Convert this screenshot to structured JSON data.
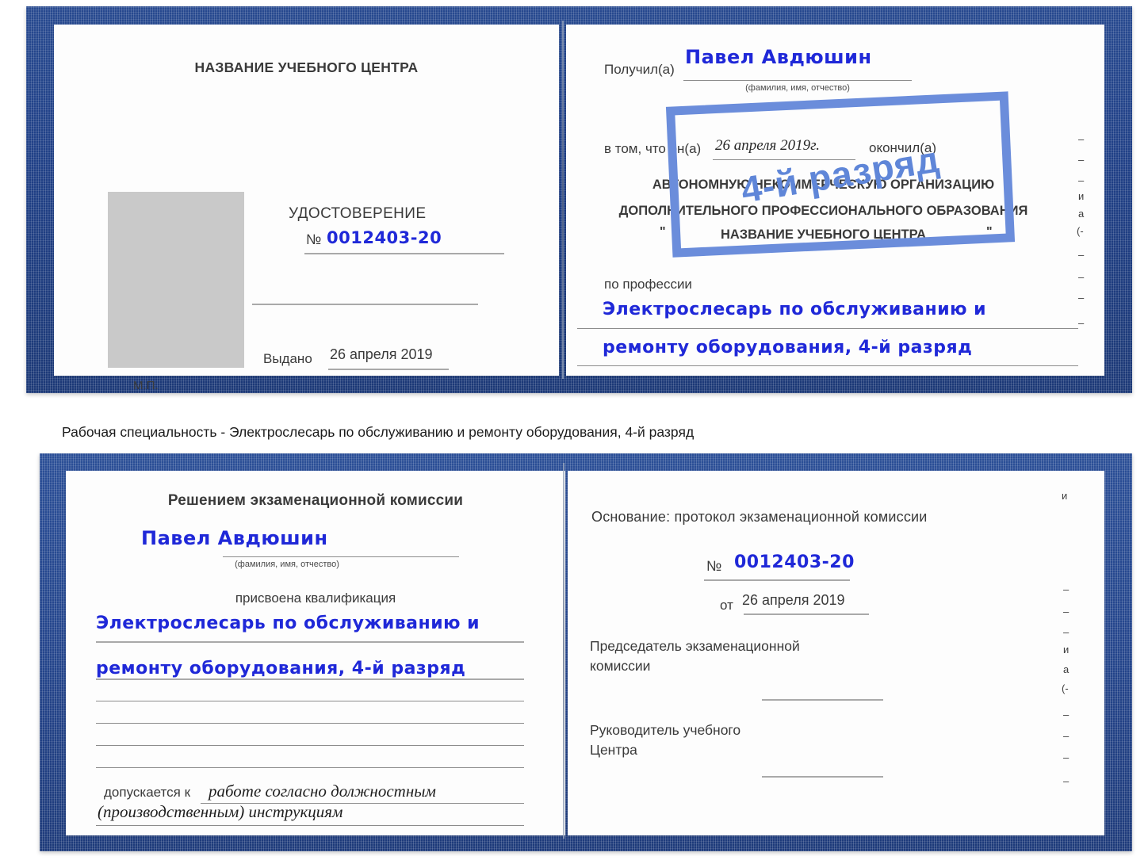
{
  "caption": {
    "text": "Рабочая специальность - Электрослесарь по обслуживанию и ремонту оборудования, 4-й разряд"
  },
  "certificate_top": {
    "left_page": {
      "header": "НАЗВАНИЕ УЧЕБНОГО ЦЕНТРА",
      "photo_placeholder": "",
      "title": "УДОСТОВЕРЕНИЕ",
      "number_symbol": "№",
      "number_value": "0012403-20",
      "issued_label": "Выдано",
      "issued_value": "26 апреля 2019",
      "seal_label": "М.П."
    },
    "right_page": {
      "received_label": "Получил(а)",
      "received_value": "Павел Авдюшин",
      "fio_hint": "(фамилия, имя, отчество)",
      "in_that_label": "в том, что он(а)",
      "date_value": "26 апреля 2019г.",
      "finished_label": "окончил(а)",
      "org_line1": "АВТОНОМНУЮ НЕКОММЕРЧЕСКУЮ ОРГАНИЗАЦИЮ",
      "org_line2": "ДОПОЛНИТЕЛЬНОГО ПРОФЕССИОНАЛЬНОГО ОБРАЗОВАНИЯ",
      "org_quote_open": "\"",
      "org_line3": "НАЗВАНИЕ УЧЕБНОГО ЦЕНТРА",
      "org_quote_close": "\"",
      "profession_label": "по профессии",
      "profession_line1": "Электрослесарь по обслуживанию и",
      "profession_line2": "ремонту оборудования, 4-й разряд",
      "stamp_text": "4-й разряд",
      "edge_fragments": [
        "–",
        "–",
        "–",
        "и",
        "а",
        "(-",
        "–",
        "–",
        "–",
        "–"
      ]
    }
  },
  "certificate_bottom": {
    "left_page": {
      "header": "Решением экзаменационной комиссии",
      "name_value": "Павел Авдюшин",
      "fio_hint": "(фамилия, имя, отчество)",
      "qualification_label": "присвоена квалификация",
      "qualification_line1": "Электрослесарь по обслуживанию и",
      "qualification_line2": "ремонту оборудования, 4-й разряд",
      "admitted_label": "допускается к",
      "admitted_value_line1": "работе согласно должностным",
      "admitted_value_line2": "(производственным) инструкциям"
    },
    "right_page": {
      "basis_label": "Основание: протокол экзаменационной комиссии",
      "number_symbol": "№",
      "number_value": "0012403-20",
      "from_label": "от",
      "from_value": "26 апреля 2019",
      "chairman_line1": "Председатель экзаменационной",
      "chairman_line2": "комиссии",
      "head_line1": "Руководитель учебного",
      "head_line2": "Центра",
      "edge_fragments": [
        "и",
        "–",
        "–",
        "–",
        "и",
        "а",
        "(-",
        "–",
        "–",
        "–",
        "–"
      ]
    }
  },
  "colors": {
    "cover_blue": "#23448b",
    "handwriting_blue": "#1f28d8",
    "stamp_blue": "#6b8ddb",
    "photo_gray": "#c9c9c9"
  }
}
